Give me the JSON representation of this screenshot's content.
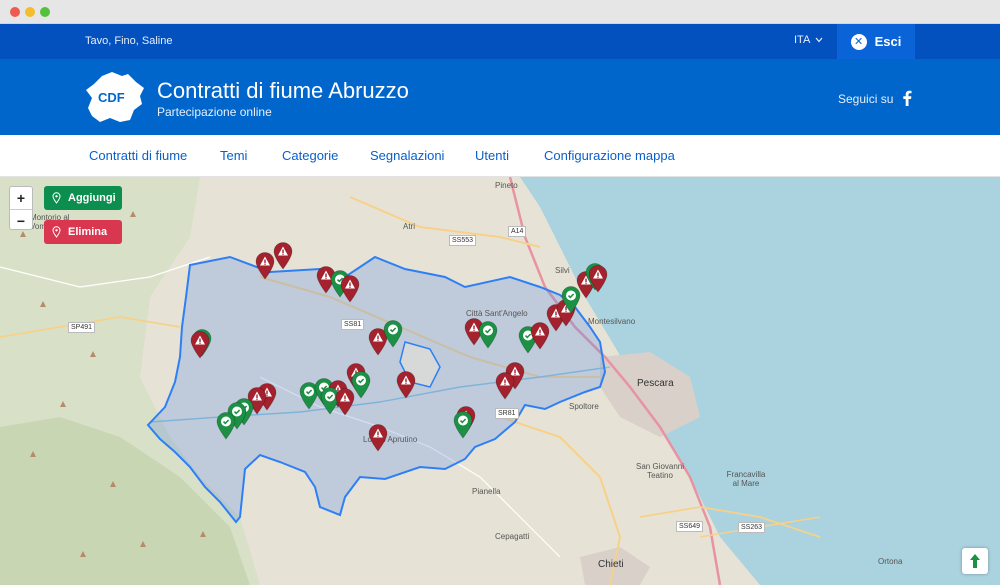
{
  "topbar": {
    "location": "Tavo, Fino, Saline",
    "language": "ITA",
    "exit_label": "Esci"
  },
  "header": {
    "logo_text": "CDF",
    "title": "Contratti di fiume Abruzzo",
    "subtitle": "Partecipazione online",
    "follow_label": "Seguici su"
  },
  "nav": [
    "Contratti di fiume",
    "Temi",
    "Categorie",
    "Segnalazioni",
    "Utenti",
    "Configurazione mappa"
  ],
  "map": {
    "zoom_in": "+",
    "zoom_out": "−",
    "add_label": "Aggiungi",
    "remove_label": "Elimina",
    "places": [
      "Pineto",
      "Atri",
      "Silvi",
      "Città Sant'Angelo",
      "Montesilvano",
      "Pescara",
      "Spoltore",
      "Loreto Aprutino",
      "Pianella",
      "Cepagatti",
      "Chieti",
      "San Giovanni Teatino",
      "Francavilla al Mare",
      "Ortona",
      "Montorio al Vomano"
    ],
    "roads": [
      "A14",
      "SS553",
      "SS81",
      "SP491",
      "SR81",
      "SS649",
      "SS263"
    ]
  },
  "colors": {
    "topbar": "#0351bf",
    "header": "#0066cc",
    "add": "#0c8f4e",
    "remove": "#d9364f",
    "marker_warning": "#a3222d",
    "marker_ok": "#1c9145"
  }
}
